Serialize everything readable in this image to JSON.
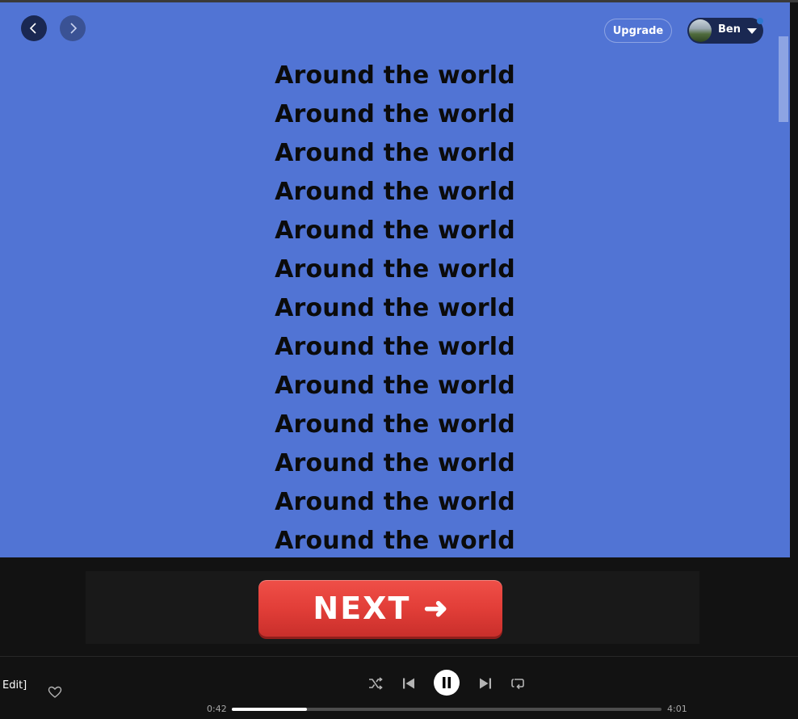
{
  "header": {
    "back_icon": "chevron-left-icon",
    "forward_icon": "chevron-right-icon",
    "upgrade_label": "Upgrade",
    "user_name": "Ben"
  },
  "lyrics": {
    "lines": [
      "Around the world",
      "Around the world",
      "Around the world",
      "Around the world",
      "Around the world",
      "Around the world",
      "Around the world",
      "Around the world",
      "Around the world",
      "Around the world",
      "Around the world",
      "Around the world",
      "Around the world"
    ]
  },
  "ad": {
    "next_label": "NEXT",
    "next_arrow": "➜"
  },
  "player": {
    "track_title": "Edit]",
    "elapsed": "0:42",
    "total": "4:01",
    "progress": 0.174
  },
  "colors": {
    "lyrics_background": "#5174d4",
    "lyric_text": "#0b0b0b",
    "ad_button": "#e23e38",
    "player_background": "#121212"
  }
}
